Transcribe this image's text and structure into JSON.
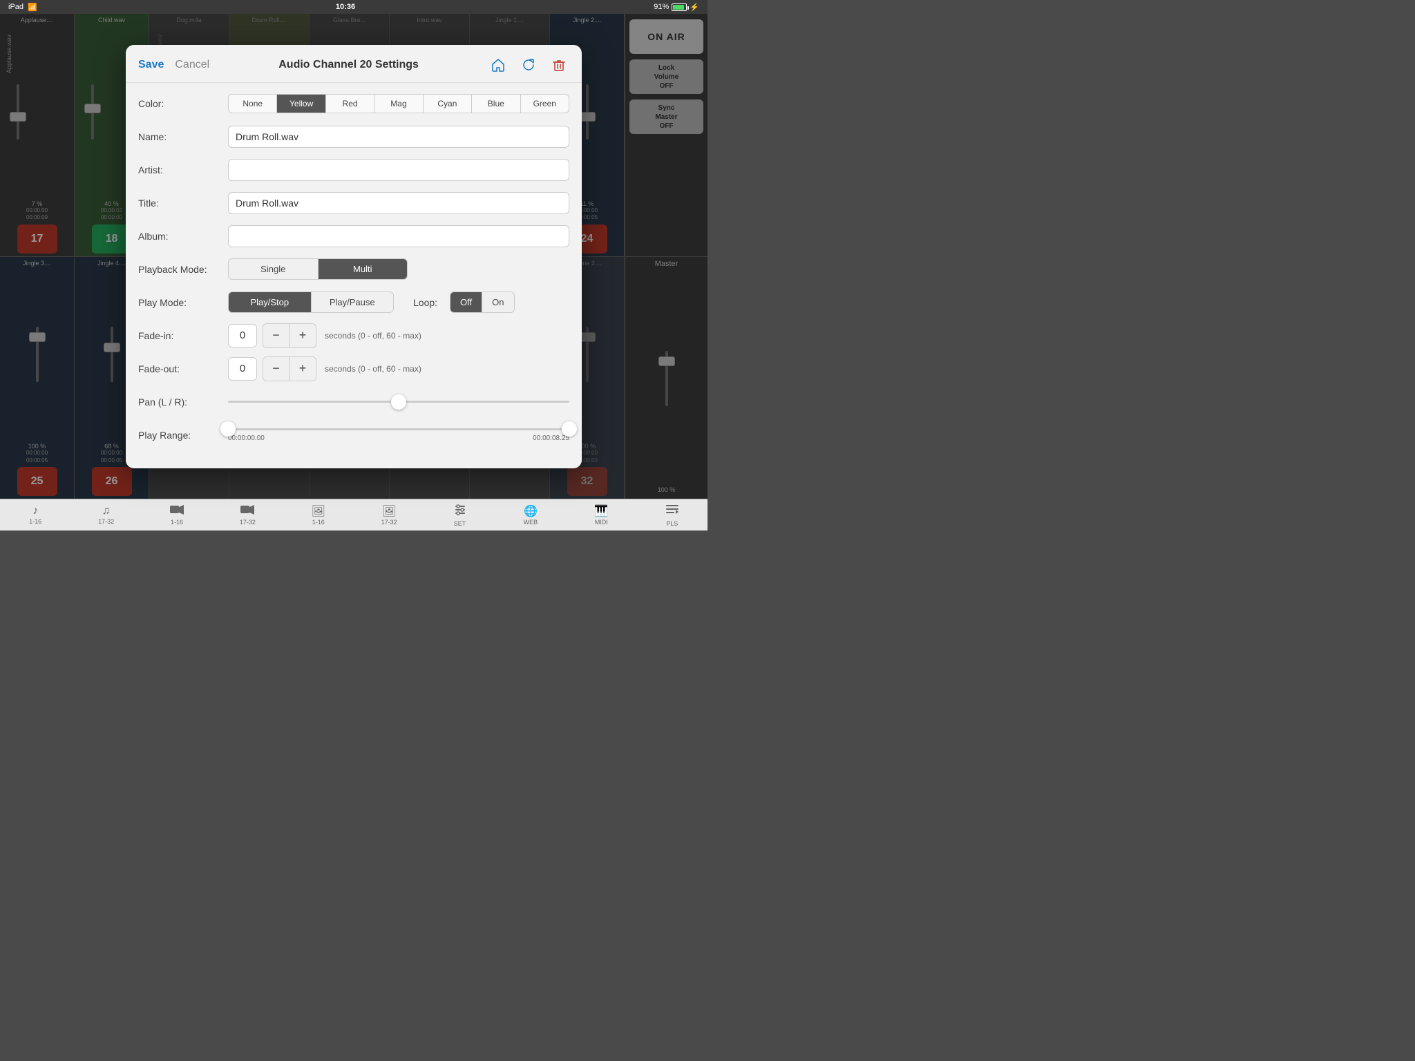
{
  "status_bar": {
    "device": "iPad",
    "wifi": "wifi",
    "time": "10:36",
    "battery_pct": "91%"
  },
  "mixer": {
    "channels_top": [
      {
        "id": "ch1",
        "name": "Applause....",
        "percent": "7 %",
        "time1": "00:00:00",
        "time2": "00:00:09",
        "number": "17",
        "color": "red"
      },
      {
        "id": "ch2",
        "name": "Child.wav",
        "percent": "40 %",
        "time1": "00:00:02",
        "time2": "00:00:00",
        "number": "18",
        "color": "green"
      },
      {
        "id": "ch5",
        "name": "Jingle 2....",
        "percent": "11 %",
        "time1": "00:00:00",
        "time2": "00:00:05",
        "number": "24",
        "color": "red"
      }
    ],
    "channels_bottom": [
      {
        "id": "ch6",
        "name": "Jingle 3....",
        "percent": "100 %",
        "time1": "00:00:00",
        "time2": "00:00:05",
        "number": "25",
        "color": "red"
      },
      {
        "id": "ch7",
        "name": "Jingle 4....",
        "percent": "68 %",
        "time1": "00:00:00",
        "time2": "00:00:05",
        "number": "26",
        "color": "red"
      },
      {
        "id": "ch8",
        "name": "Scene 2....",
        "percent": "100 %",
        "time1": "00:00:00",
        "time2": "00:00:02",
        "number": "32",
        "color": "red"
      }
    ],
    "top_headers": [
      "Applause....",
      "Child.wav",
      "Dog.m4a",
      "Drum Roll....",
      "Glass Bre...",
      "Intro.wav",
      "Jingle 1....",
      "Jingle 2...."
    ],
    "bottom_headers": [
      "Jingle 3....",
      "Jingle 4....",
      "Scene 2....",
      "Master"
    ],
    "right_panel": {
      "on_air": "ON AIR",
      "lock_volume": "Lock\nVolume\nOFF",
      "sync_master": "Sync\nMaster\nOFF"
    }
  },
  "modal": {
    "save_label": "Save",
    "cancel_label": "Cancel",
    "title": "Audio Channel 20 Settings",
    "color_label": "Color:",
    "colors": [
      "None",
      "Yellow",
      "Red",
      "Mag",
      "Cyan",
      "Blue",
      "Green"
    ],
    "selected_color": "Yellow",
    "name_label": "Name:",
    "name_value": "Drum Roll.wav",
    "artist_label": "Artist:",
    "artist_value": "",
    "title_label": "Title:",
    "title_value": "Drum Roll.wav",
    "album_label": "Album:",
    "album_value": "",
    "playback_mode_label": "Playback Mode:",
    "playback_modes": [
      "Single",
      "Multi"
    ],
    "selected_playback_mode": "Multi",
    "play_mode_label": "Play Mode:",
    "play_modes": [
      "Play/Stop",
      "Play/Pause"
    ],
    "selected_play_mode": "Play/Stop",
    "loop_label": "Loop:",
    "loop_options": [
      "Off",
      "On"
    ],
    "selected_loop": "Off",
    "fade_in_label": "Fade-in:",
    "fade_in_value": "0",
    "fade_in_desc": "seconds (0 - off, 60 - max)",
    "fade_out_label": "Fade-out:",
    "fade_out_value": "0",
    "fade_out_desc": "seconds (0 - off, 60 - max)",
    "pan_label": "Pan (L / R):",
    "pan_value": 50,
    "play_range_label": "Play Range:",
    "play_range_start": "00:00:00.00",
    "play_range_end": "00:00:08.25"
  },
  "tabs": [
    {
      "icon": "♪",
      "label": "1-16"
    },
    {
      "icon": "♫",
      "label": "17-32"
    },
    {
      "icon": "🎥",
      "label": "1-16"
    },
    {
      "icon": "📹",
      "label": "17-32"
    },
    {
      "icon": "🖼",
      "label": "1-16"
    },
    {
      "icon": "🖼",
      "label": "17-32"
    },
    {
      "icon": "⚙",
      "label": "SET"
    },
    {
      "icon": "🌐",
      "label": "WEB"
    },
    {
      "icon": "🎹",
      "label": "MIDI"
    },
    {
      "icon": "≡",
      "label": "PLS"
    }
  ]
}
